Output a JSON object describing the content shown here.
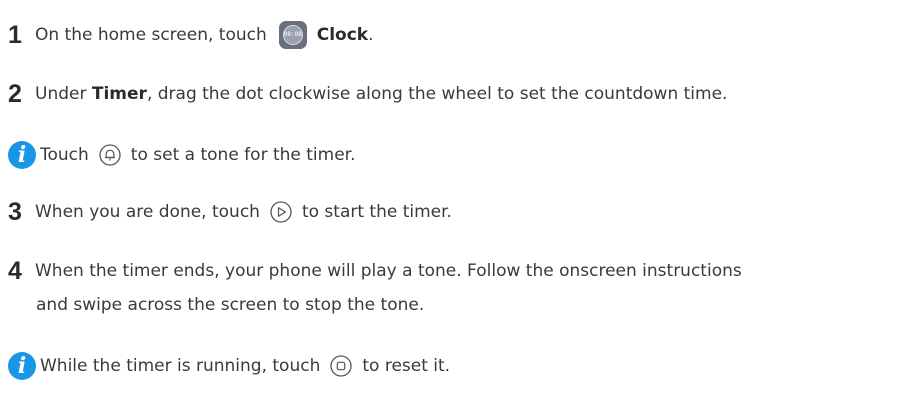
{
  "steps": [
    {
      "num": "1",
      "pre": "On the home screen, touch",
      "bold": "Clock",
      "post": "."
    },
    {
      "num": "2",
      "pre": "Under",
      "bold": "Timer",
      "post": ", drag the dot clockwise along the wheel to set the countdown time."
    },
    {
      "num": "3",
      "pre": "When you are done, touch",
      "post": "to start the timer."
    },
    {
      "num": "4",
      "line1": "When the timer ends, your phone will play a tone. Follow the onscreen instructions",
      "line2": "and swipe across the screen to stop the tone."
    }
  ],
  "tips": [
    {
      "pre": "Touch",
      "post": "to set a tone for the timer."
    },
    {
      "pre": "While the timer is running, touch",
      "post": "to reset it."
    }
  ],
  "icons": {
    "info_glyph": "i",
    "clock_app_text": "08:08",
    "accent": "#1a96e8"
  }
}
